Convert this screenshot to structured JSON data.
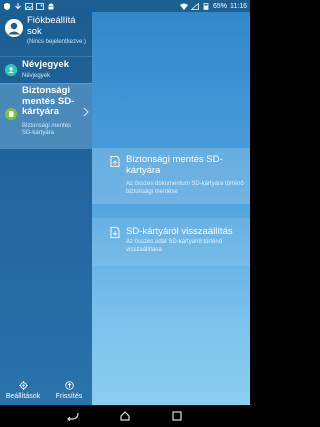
{
  "status_bar": {
    "battery": "65%",
    "time": "11:16"
  },
  "drawer": {
    "profile": {
      "title": "Fiókbeállítá sok",
      "subtitle": "(Nincs bejelentkezve.)"
    },
    "items": [
      {
        "title": "Névjegyek",
        "subtitle": "Névjegyek",
        "icon": "contacts-icon"
      },
      {
        "title": "Biztonsági mentés SD-kártyára",
        "subtitle": "Biztonsági mentés SD-kártyára",
        "icon": "sd-backup-icon"
      }
    ],
    "bottom": {
      "settings_label": "Beállítások",
      "refresh_label": "Frissítés"
    }
  },
  "main": {
    "cards": [
      {
        "title": "Biztonsági mentés SD-kártyára",
        "subtitle": "Az összes dokumentum SD-kártyára történő biztonsági mentése"
      },
      {
        "title": "SD-kártyáról visszaállítás",
        "subtitle": "Az összes adat SD-kártyáról történő visszaállítása"
      }
    ]
  },
  "colors": {
    "accent": "#2f86c9",
    "drawer": "#1b5e93",
    "contacts_icon": "#2fc6b4",
    "backup_icon": "#7ac143"
  }
}
